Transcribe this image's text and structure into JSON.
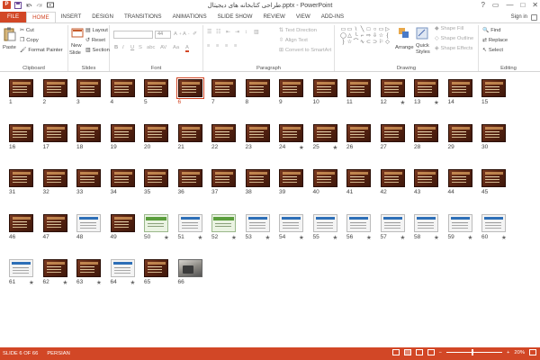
{
  "window": {
    "title": "طراحی کتابخانه های دیجیتال.pptx - PowerPoint",
    "controls": [
      "?",
      "▭",
      "—",
      "□",
      "✕"
    ]
  },
  "quick_access": [
    "save-icon",
    "undo-icon",
    "redo-icon",
    "start-presentation-icon"
  ],
  "tabs": [
    "FILE",
    "HOME",
    "INSERT",
    "DESIGN",
    "TRANSITIONS",
    "ANIMATIONS",
    "SLIDE SHOW",
    "REVIEW",
    "VIEW",
    "ADD-INS"
  ],
  "active_tab": "HOME",
  "sign_in": "Sign in",
  "ribbon": {
    "clipboard": {
      "label": "Clipboard",
      "paste": "Paste",
      "cut": "Cut",
      "copy": "Copy",
      "format_painter": "Format Painter"
    },
    "slides": {
      "label": "Slides",
      "new_slide": "New",
      "new_slide2": "Slide",
      "layout": "Layout",
      "reset": "Reset",
      "section": "Section"
    },
    "font": {
      "label": "Font",
      "size": "44",
      "bold": "B",
      "italic": "I",
      "underline": "U",
      "strike": "S",
      "shadow": "abc",
      "spacing": "AV",
      "case": "Aa",
      "color": "A"
    },
    "paragraph": {
      "label": "Paragraph",
      "text_direction": "Text Direction",
      "align_text": "Align Text",
      "convert_smartart": "Convert to SmartArt"
    },
    "drawing": {
      "label": "Drawing",
      "arrange": "Arrange",
      "quick_styles": "Quick",
      "quick_styles2": "Styles",
      "shape_fill": "Shape Fill",
      "shape_outline": "Shape Outline",
      "shape_effects": "Shape Effects",
      "shapes": [
        "▭",
        "▭",
        "\\",
        "╲",
        "□",
        "○",
        "▭",
        "▷",
        "◯",
        "△",
        "└",
        "⌐",
        "⇨",
        "⇩",
        "☆",
        "{",
        "}",
        "☆",
        "⌒",
        "∿",
        "⊂",
        "⊃",
        "⚐",
        "◇"
      ]
    },
    "editing": {
      "label": "Editing",
      "find": "Find",
      "replace": "Replace",
      "select": "Select"
    }
  },
  "slides": [
    {
      "n": "1",
      "star": "",
      "style": "dark"
    },
    {
      "n": "2",
      "star": "",
      "style": "dark"
    },
    {
      "n": "3",
      "star": "",
      "style": "dark"
    },
    {
      "n": "4",
      "star": "",
      "style": "dark"
    },
    {
      "n": "5",
      "star": "",
      "style": "dark"
    },
    {
      "n": "6",
      "star": "",
      "style": "dark",
      "selected": true
    },
    {
      "n": "7",
      "star": "",
      "style": "dark"
    },
    {
      "n": "8",
      "star": "",
      "style": "dark"
    },
    {
      "n": "9",
      "star": "",
      "style": "dark"
    },
    {
      "n": "10",
      "star": "",
      "style": "dark"
    },
    {
      "n": "11",
      "star": "",
      "style": "dark"
    },
    {
      "n": "12",
      "star": "★",
      "style": "dark"
    },
    {
      "n": "13",
      "star": "★",
      "style": "dark"
    },
    {
      "n": "14",
      "star": "",
      "style": "dark"
    },
    {
      "n": "15",
      "star": "",
      "style": "dark"
    },
    {
      "n": "16",
      "star": "",
      "style": "dark"
    },
    {
      "n": "17",
      "star": "",
      "style": "dark"
    },
    {
      "n": "18",
      "star": "",
      "style": "dark"
    },
    {
      "n": "19",
      "star": "",
      "style": "dark"
    },
    {
      "n": "20",
      "star": "",
      "style": "dark"
    },
    {
      "n": "21",
      "star": "",
      "style": "dark"
    },
    {
      "n": "22",
      "star": "",
      "style": "dark"
    },
    {
      "n": "23",
      "star": "",
      "style": "dark"
    },
    {
      "n": "24",
      "star": "★",
      "style": "dark"
    },
    {
      "n": "25",
      "star": "★",
      "style": "dark"
    },
    {
      "n": "26",
      "star": "",
      "style": "dark"
    },
    {
      "n": "27",
      "star": "",
      "style": "dark"
    },
    {
      "n": "28",
      "star": "",
      "style": "dark"
    },
    {
      "n": "29",
      "star": "",
      "style": "dark"
    },
    {
      "n": "30",
      "star": "",
      "style": "dark"
    },
    {
      "n": "31",
      "star": "",
      "style": "dark"
    },
    {
      "n": "32",
      "star": "",
      "style": "dark"
    },
    {
      "n": "33",
      "star": "",
      "style": "dark"
    },
    {
      "n": "34",
      "star": "",
      "style": "dark"
    },
    {
      "n": "35",
      "star": "",
      "style": "dark"
    },
    {
      "n": "36",
      "star": "",
      "style": "dark"
    },
    {
      "n": "37",
      "star": "",
      "style": "dark"
    },
    {
      "n": "38",
      "star": "",
      "style": "dark"
    },
    {
      "n": "39",
      "star": "",
      "style": "dark"
    },
    {
      "n": "40",
      "star": "",
      "style": "dark"
    },
    {
      "n": "41",
      "star": "",
      "style": "dark"
    },
    {
      "n": "42",
      "star": "",
      "style": "dark"
    },
    {
      "n": "43",
      "star": "",
      "style": "dark"
    },
    {
      "n": "44",
      "star": "",
      "style": "dark"
    },
    {
      "n": "45",
      "star": "",
      "style": "dark"
    },
    {
      "n": "46",
      "star": "",
      "style": "dark"
    },
    {
      "n": "47",
      "star": "",
      "style": "dark"
    },
    {
      "n": "48",
      "star": "",
      "style": "light"
    },
    {
      "n": "49",
      "star": "",
      "style": "dark"
    },
    {
      "n": "50",
      "star": "★",
      "style": "green"
    },
    {
      "n": "51",
      "star": "★",
      "style": "light"
    },
    {
      "n": "52",
      "star": "★",
      "style": "green"
    },
    {
      "n": "53",
      "star": "★",
      "style": "light"
    },
    {
      "n": "54",
      "star": "★",
      "style": "light"
    },
    {
      "n": "55",
      "star": "★",
      "style": "light"
    },
    {
      "n": "56",
      "star": "★",
      "style": "light"
    },
    {
      "n": "57",
      "star": "★",
      "style": "light"
    },
    {
      "n": "58",
      "star": "★",
      "style": "light"
    },
    {
      "n": "59",
      "star": "★",
      "style": "light"
    },
    {
      "n": "60",
      "star": "★",
      "style": "light"
    },
    {
      "n": "61",
      "star": "★",
      "style": "light"
    },
    {
      "n": "62",
      "star": "★",
      "style": "dark"
    },
    {
      "n": "63",
      "star": "★",
      "style": "dark"
    },
    {
      "n": "64",
      "star": "★",
      "style": "light"
    },
    {
      "n": "65",
      "star": "",
      "style": "dark"
    },
    {
      "n": "66",
      "star": "",
      "style": "photo"
    }
  ],
  "status": {
    "slide": "SLIDE 6 OF 66",
    "language": "PERSIAN",
    "zoom": "20%",
    "minus": "−",
    "plus": "+"
  },
  "colors": {
    "accent": "#d24726"
  }
}
